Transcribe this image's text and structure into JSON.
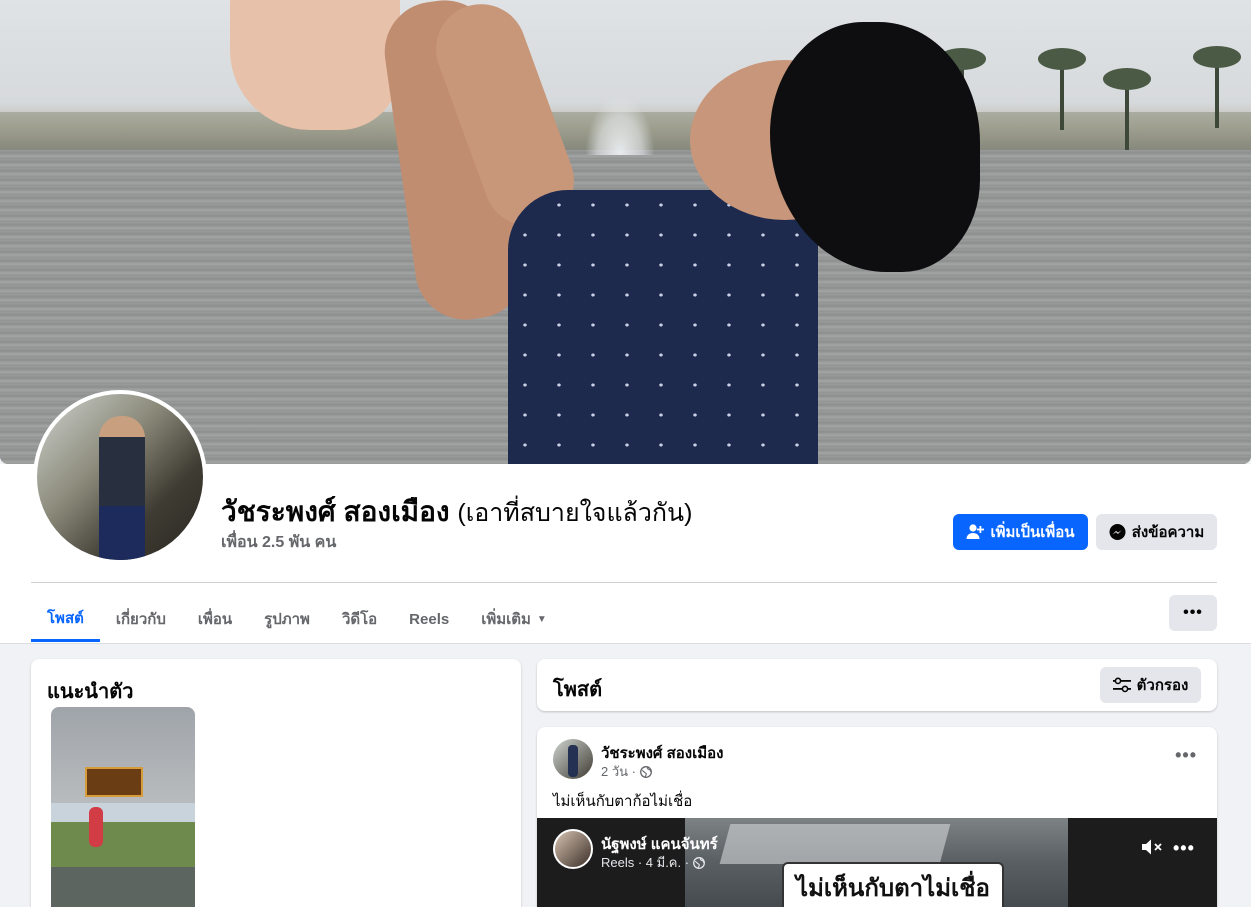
{
  "profile": {
    "name": "วัชระพงศ์ สองเมือง",
    "alternate_name": "(เอาที่สบายใจแล้วกัน)",
    "friends": "เพื่อน 2.5 พัน คน"
  },
  "actions": {
    "add_friend": "เพิ่มเป็นเพื่อน",
    "message": "ส่งข้อความ",
    "more": "•••"
  },
  "tabs": [
    {
      "label": "โพสต์",
      "active": true
    },
    {
      "label": "เกี่ยวกับ",
      "active": false
    },
    {
      "label": "เพื่อน",
      "active": false
    },
    {
      "label": "รูปภาพ",
      "active": false
    },
    {
      "label": "วิดีโอ",
      "active": false
    },
    {
      "label": "Reels",
      "active": false
    },
    {
      "label": "เพิ่มเติม",
      "active": false
    }
  ],
  "intro": {
    "title": "แนะนำตัว",
    "featured_logo_text": "มนทัดปี"
  },
  "posts_header": {
    "title": "โพสต์",
    "filter": "ตัวกรอง"
  },
  "post": {
    "author": "วัชระพงศ์ สองเมือง",
    "time": "2 วัน ·",
    "text": "ไม่เห็นกับตาก้อไม่เชื่อ",
    "more": "•••",
    "shared_reel": {
      "author": "นัฐพงษ์ แคนจันทร์",
      "meta": "Reels · 4 มี.ค. ·",
      "caption": "ไม่เห็นกับตาไม่เชื่อ",
      "more": "•••"
    }
  },
  "colors": {
    "primary": "#0866ff",
    "secondary_button": "#e4e6eb",
    "background": "#f0f2f5",
    "muted_text": "#65676b"
  },
  "icons": [
    "add-friend-icon",
    "messenger-icon",
    "caret-down-icon",
    "filter-icon",
    "globe-icon",
    "mute-icon",
    "more-icon"
  ]
}
